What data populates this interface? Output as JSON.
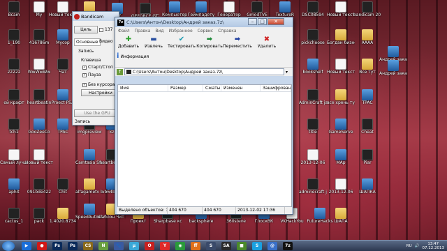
{
  "desktop_icons": [
    {
      "label": "Bcam",
      "x": 0
    },
    {
      "label": "My",
      "x": 0
    },
    {
      "label": "Новый текстовый",
      "x": 0
    },
    {
      "label": "Новая папка (5)",
      "x": 0
    },
    {
      "label": "5gf",
      "x": 0
    },
    {
      "label": "GEFORCE GTX",
      "x": 0
    },
    {
      "label": "Компьютер",
      "x": 0
    },
    {
      "label": "Геймпадоту",
      "x": 0
    },
    {
      "label": "Генератор",
      "x": 0
    },
    {
      "label": "GmodTVE",
      "x": 0
    },
    {
      "label": "TextureR",
      "x": 0
    },
    {
      "label": "DSC08594",
      "x": 0
    },
    {
      "label": "Новый текстовый",
      "x": 0
    },
    {
      "label": "bandicam 2013-12-05",
      "x": 0
    },
    {
      "label": "1_190",
      "x": 0
    },
    {
      "label": "416786m",
      "x": 0
    },
    {
      "label": "Mycop",
      "x": 0
    },
    {
      "label": "pickchoose",
      "x": 0
    },
    {
      "label": "Богдан бизнес",
      "x": 0
    },
    {
      "label": "АААА",
      "x": 0
    },
    {
      "label": "Андрей заказ",
      "x": 0
    },
    {
      "label": "22222",
      "x": 0
    },
    {
      "label": "WwWwWw",
      "x": 0
    },
    {
      "label": "Чат",
      "x": 0
    },
    {
      "label": "bookshelf",
      "x": 0
    },
    {
      "label": "Новый текстовый",
      "x": 0
    },
    {
      "label": "Все тут",
      "x": 0
    },
    {
      "label": "Андрей заказ",
      "x": 0
    },
    {
      "label": "ой крафт",
      "x": 0
    },
    {
      "label": "heartbeatin",
      "x": 0
    },
    {
      "label": "Proect PSA",
      "x": 0
    },
    {
      "label": "AdminCraft java",
      "x": 0
    },
    {
      "label": "все хрень тута",
      "x": 0
    },
    {
      "label": "TPAC",
      "x": 0
    },
    {
      "label": "tch1",
      "x": 0
    },
    {
      "label": "GooZeeCo",
      "x": 0
    },
    {
      "label": "TPAC",
      "x": 0
    },
    {
      "label": "imgpreview",
      "x": 0
    },
    {
      "label": "kz",
      "x": 0
    },
    {
      "label": "title",
      "x": 0
    },
    {
      "label": "GameServe",
      "x": 0
    },
    {
      "label": "Cheat",
      "x": 0
    },
    {
      "label": "Самый лучший кл",
      "x": 0
    },
    {
      "label": "Новый текстовый",
      "x": 0
    },
    {
      "label": "Camtasia Studio 7",
      "x": 0
    },
    {
      "label": "heartbeatin",
      "x": 0
    },
    {
      "label": "2013-12-06",
      "x": 0
    },
    {
      "label": "MAp",
      "x": 0
    },
    {
      "label": "Piar",
      "x": 0
    },
    {
      "label": "aphit",
      "x": 0
    },
    {
      "label": "091bde422",
      "x": 0
    },
    {
      "label": "Chit",
      "x": 0
    },
    {
      "label": "alfagametv bumgcreed",
      "x": 0
    },
    {
      "label": "vb64bigg",
      "x": 0
    },
    {
      "label": "adminecraft java 2",
      "x": 0
    },
    {
      "label": "2013-12-06",
      "x": 0
    },
    {
      "label": "ШАПКА",
      "x": 0
    },
    {
      "label": "cactus_1",
      "x": 0
    },
    {
      "label": "pack",
      "x": 0
    },
    {
      "label": "1.4020.8734",
      "x": 0
    },
    {
      "label": "SpeedAutoCl Aleksandro",
      "x": 0
    },
    {
      "label": "шаблон Чит Варфейс",
      "x": 0
    },
    {
      "label": "Проект",
      "x": 0
    },
    {
      "label": "Sharpbase копия",
      "x": 0
    },
    {
      "label": "backsphere",
      "x": 0
    },
    {
      "label": "360steve",
      "x": 0
    },
    {
      "label": "ГлоскВК",
      "x": 0
    },
    {
      "label": "VKHackYou",
      "x": 0
    },
    {
      "label": "FutureHacks",
      "x": 0
    },
    {
      "label": "ШАПА",
      "x": 0
    }
  ],
  "bandicam": {
    "title": "Bandicam",
    "target_button": "Цель",
    "field_value": "137",
    "tabs": [
      "Основные",
      "Видео"
    ],
    "section_record": "Запись",
    "section_hotkey": "Клавиша",
    "start_stop": "Старт/Стоп",
    "pause": "Пауза",
    "no_cursor": "Без курсора",
    "settings_button": "Настройки",
    "use_gpu": "Use the GPU",
    "recording_status": "Запись",
    "recording_time": "00:00"
  },
  "zip": {
    "title": "C:\\Users\\Антон\\Desktop\\Андрей заказ.7z\\",
    "logo": "7z",
    "menu": [
      "Файл",
      "Правка",
      "Вид",
      "Избранное",
      "Сервис",
      "Справка"
    ],
    "tools": [
      {
        "label": "Добавить",
        "icon": "✚",
        "color": "#2ea02e"
      },
      {
        "label": "Извлечь",
        "icon": "▬",
        "color": "#2a4fa0"
      },
      {
        "label": "Тестировать",
        "icon": "✔",
        "color": "#1a9ab0"
      },
      {
        "label": "Копировать",
        "icon": "➡",
        "color": "#1f8a3a"
      },
      {
        "label": "Переместить",
        "icon": "➡",
        "color": "#1f3fa0"
      },
      {
        "label": "Удалить",
        "icon": "✖",
        "color": "#d02020"
      },
      {
        "label": "Информация",
        "icon": "i",
        "color": "#2a6ad0"
      }
    ],
    "address": "C:\\Users\\Антон\\Desktop\\Андрей заказ.7z\\",
    "columns": [
      "Имя",
      "Размер",
      "Сжатый",
      "Изменен",
      "Зашифрован"
    ],
    "status": {
      "selected": "Выделено объектов: 1",
      "size": "404 670",
      "packed": "404 670",
      "date": "2013-12-02 17:36"
    }
  },
  "taskbar": {
    "apps": [
      {
        "name": "windows-media-player",
        "color": "#1a6ed8",
        "glyph": "▶"
      },
      {
        "name": "record",
        "color": "#d01818",
        "glyph": "●"
      },
      {
        "name": "photoshop",
        "color": "#0a2a5a",
        "glyph": "Ps"
      },
      {
        "name": "photoshop-2",
        "color": "#0a2a5a",
        "glyph": "Ps"
      },
      {
        "name": "counter-strike",
        "color": "#8a6a1a",
        "glyph": "CS"
      },
      {
        "name": "notepad-plus",
        "color": "#6aa040",
        "glyph": "N"
      },
      {
        "name": "paw",
        "color": "#3a5aa0",
        "glyph": "🐾"
      },
      {
        "name": "utorrent",
        "color": "#3aa8d8",
        "glyph": "µ"
      },
      {
        "name": "opera",
        "color": "#c82020",
        "glyph": "O"
      },
      {
        "name": "yandex",
        "color": "#e02a2a",
        "glyph": "Y"
      },
      {
        "name": "chrome",
        "color": "#2a9a3a",
        "glyph": "◉"
      },
      {
        "name": "firefox",
        "color": "#e0701a",
        "glyph": "ff"
      },
      {
        "name": "steam",
        "color": "#3a4a6a",
        "glyph": "S"
      },
      {
        "name": "gta",
        "color": "#2a2a2a",
        "glyph": "SA"
      },
      {
        "name": "minecraft",
        "color": "#4a8a2a",
        "glyph": "■"
      },
      {
        "name": "skype",
        "color": "#1aa0e0",
        "glyph": "S"
      },
      {
        "name": "mail",
        "color": "#3a70c8",
        "glyph": "@"
      },
      {
        "name": "7zip",
        "color": "#111111",
        "glyph": "7z"
      }
    ],
    "lang": "RU",
    "time": "13:47",
    "date": "07.12.2013"
  }
}
